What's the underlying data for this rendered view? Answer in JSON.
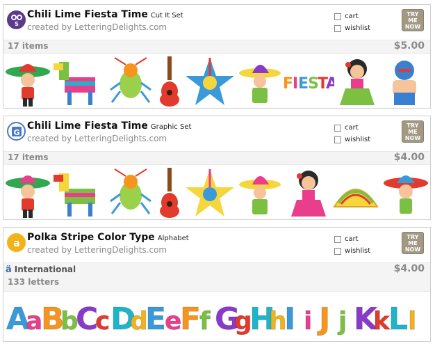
{
  "cards": [
    {
      "title": "Chili Lime Fiesta Time",
      "subtype": "Cut It Set",
      "creator": "created by LetteringDelights.com",
      "icon": "scissors-icon",
      "count": "17 items",
      "price": "$5.00",
      "cart_label": "cart",
      "wishlist_label": "wishlist",
      "try_label": "TRY ME NOW"
    },
    {
      "title": "Chili Lime Fiesta Time",
      "subtype": "Graphic Set",
      "creator": "created by LetteringDelights.com",
      "icon": "graphic-set-icon",
      "count": "17 items",
      "price": "$4.00",
      "cart_label": "cart",
      "wishlist_label": "wishlist",
      "try_label": "TRY ME NOW"
    },
    {
      "title": "Polka Stripe Color Type",
      "subtype": "Alphabet",
      "creator": "created by LetteringDelights.com",
      "icon": "alphabet-icon",
      "international": "International",
      "count": "133 letters",
      "price": "$4.00",
      "cart_label": "cart",
      "wishlist_label": "wishlist",
      "try_label": "TRY ME NOW",
      "letters": [
        "A",
        "a",
        "B",
        "b",
        "C",
        "c",
        "D",
        "d",
        "E",
        "e",
        "F",
        "f",
        "G",
        "g",
        "H",
        "h",
        "I",
        "i",
        "J",
        "j",
        "K",
        "k",
        "L",
        "l"
      ]
    }
  ],
  "colors": {
    "try_button": "#a29884",
    "scissors_icon": "#5b3a8c",
    "graphic_icon": "#4a78c8",
    "alphabet_icon": "#f2b21b"
  }
}
